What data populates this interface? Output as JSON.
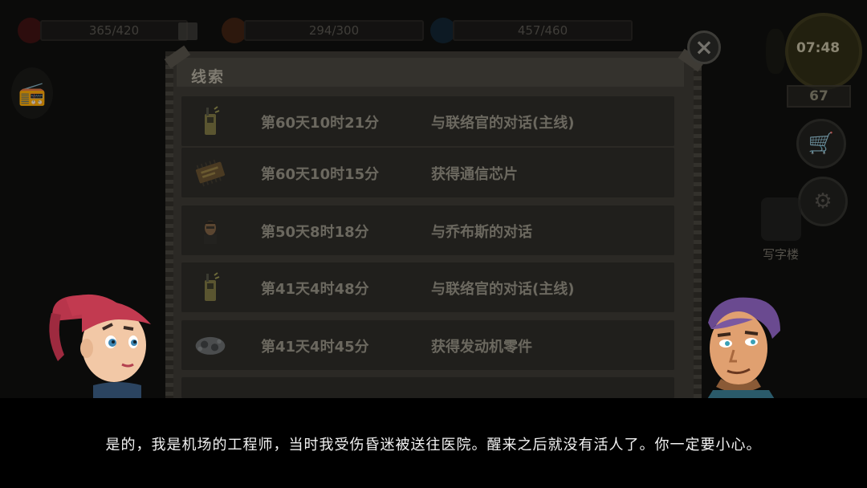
{
  "hud": {
    "blood": "365/420",
    "hunger": "294/300",
    "water": "457/460",
    "clock": "07:48",
    "day": "67",
    "building_label": "写字楼"
  },
  "panel": {
    "title": "线索",
    "entries": [
      {
        "icon": "walkie-talkie-icon",
        "time": "第60天10时21分",
        "desc": "与联络官的对话(主线)"
      },
      {
        "icon": "circuit-chip-icon",
        "time": "第60天10时15分",
        "desc": "获得通信芯片"
      },
      {
        "icon": "jobs-portrait-icon",
        "time": "第50天8时18分",
        "desc": "与乔布斯的对话"
      },
      {
        "icon": "walkie-talkie-icon",
        "time": "第41天4时48分",
        "desc": "与联络官的对话(主线)"
      },
      {
        "icon": "engine-part-icon",
        "time": "第41天4时45分",
        "desc": "获得发动机零件"
      }
    ]
  },
  "dialog": {
    "text": "是的，我是机场的工程师，当时我受伤昏迷被送往医院。醒来之后就没有活人了。你一定要小心。"
  },
  "colors": {
    "panel_bg": "#2b2925",
    "row_bg": "#201f1c",
    "row_text": "#6b685f",
    "dialog_text": "#f2f2f2"
  }
}
